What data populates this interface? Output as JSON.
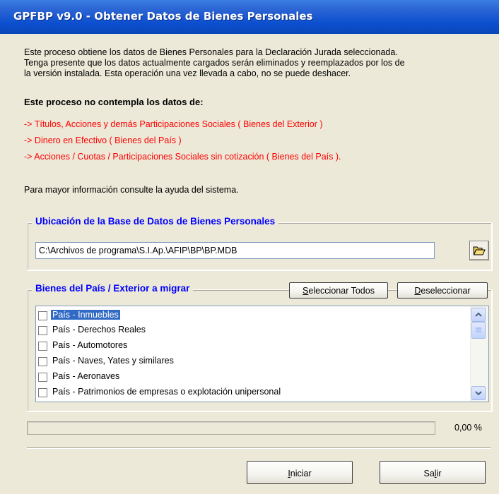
{
  "window": {
    "title": "GPFBP v9.0 - Obtener Datos de Bienes Personales"
  },
  "intro": {
    "line1": "Este proceso obtiene los datos de Bienes Personales para la Declaración Jurada seleccionada.",
    "line2": "Tenga presente que los datos actualmente cargados serán eliminados y reemplazados por los de",
    "line3": "la versión instalada. Esta operación una vez llevada a cabo, no se puede deshacer."
  },
  "notice": {
    "heading": "Este proceso no contempla los datos de:",
    "items": [
      "-> Títulos, Acciones y demás Participaciones Sociales ( Bienes del Exterior )",
      "-> Dinero en Efectivo ( Bienes del País )",
      "-> Acciones / Cuotas / Participaciones Sociales sin cotización ( Bienes del País )."
    ],
    "help": "Para mayor información consulte la ayuda del sistema."
  },
  "location": {
    "group_title": "Ubicación de la Base de Datos de Bienes Personales",
    "path": "C:\\Archivos de programa\\S.I.Ap.\\AFIP\\BP\\BP.MDB",
    "browse_icon": "open-folder-icon"
  },
  "migrate": {
    "group_title": "Bienes del País / Exterior a migrar",
    "select_all_u": "S",
    "select_all_rest": "eleccionar Todos",
    "deselect_u": "D",
    "deselect_rest": "eseleccionar",
    "items": [
      {
        "label": "País - Inmuebles",
        "checked": false,
        "selected": true
      },
      {
        "label": "País - Derechos Reales",
        "checked": false,
        "selected": false
      },
      {
        "label": "País - Automotores",
        "checked": false,
        "selected": false
      },
      {
        "label": "País - Naves, Yates y similares",
        "checked": false,
        "selected": false
      },
      {
        "label": "País - Aeronaves",
        "checked": false,
        "selected": false
      },
      {
        "label": "País - Patrimonios de empresas o explotación unipersonal",
        "checked": false,
        "selected": false
      }
    ]
  },
  "progress": {
    "value": 0,
    "text": "0,00 %"
  },
  "buttons": {
    "start_u": "I",
    "start_rest": "niciar",
    "exit_pre": "Sa",
    "exit_u": "l",
    "exit_rest": "ir"
  },
  "colors": {
    "title_bar": "#0B4FCF",
    "warning_text": "#FF0000",
    "group_title": "#0000FF",
    "selection": "#316AC5"
  }
}
